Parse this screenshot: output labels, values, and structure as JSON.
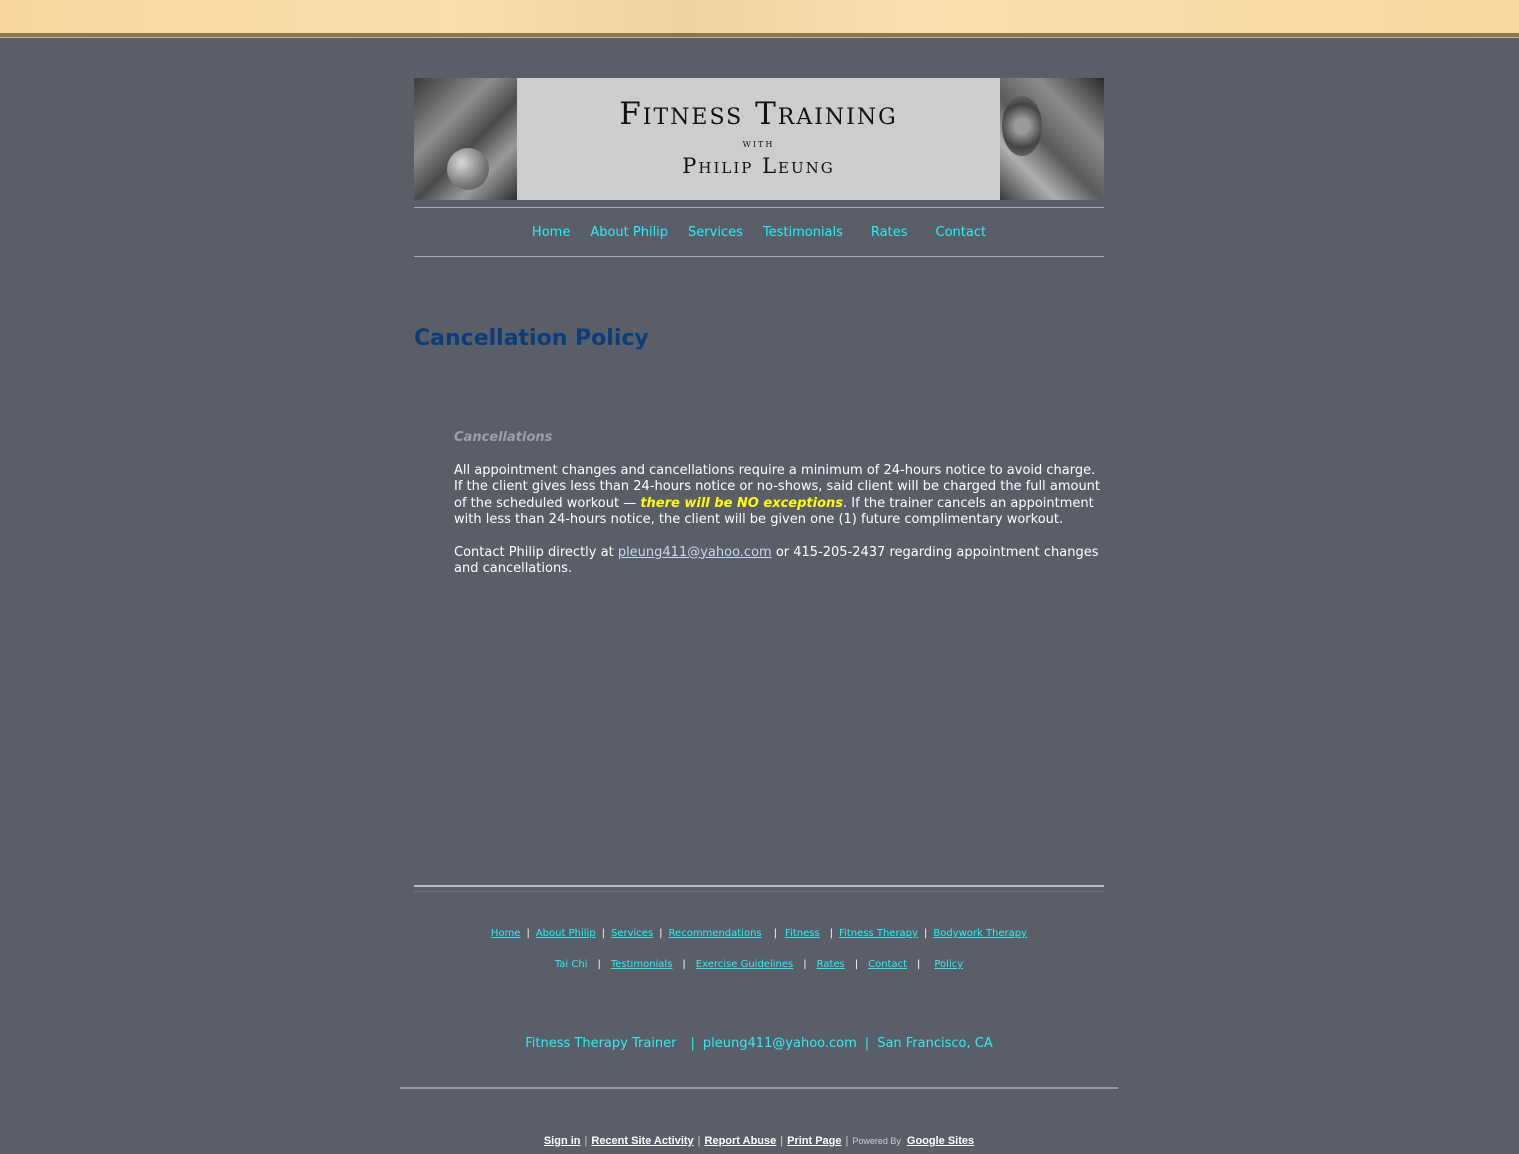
{
  "banner": {
    "title_line1": "Fitness Training",
    "title_line2": "with",
    "title_line3": "Philip Leung"
  },
  "nav": {
    "items": [
      "Home",
      "About Philip",
      "Services",
      "Testimonials",
      "Rates",
      "Contact"
    ]
  },
  "page": {
    "title": "Cancellation Policy",
    "section_heading": "Cancellations",
    "paragraph1_before": "All appointment changes and cancellations require a minimum of 24-hours notice to avoid charge. If the client gives less than 24-hours notice or no-shows, said client will be charged the full amount of the scheduled workout — ",
    "paragraph1_highlight": "there will be NO exceptions",
    "paragraph1_after": ".  If the trainer cancels an appointment with less than 24-hours notice, the client will be given one (1) future complimentary workout.",
    "paragraph2_before": "Contact Philip directly at ",
    "paragraph2_email": "pleung411@yahoo.com",
    "paragraph2_after": " or 415-205-2437 regarding appointment changes and cancellations."
  },
  "footer": {
    "row1": [
      "Home",
      "About Philip",
      "Services",
      "Recommendations",
      "Fitness",
      "Fitness Therapy",
      "Bodywork Therapy"
    ],
    "row2_plain": "Tai Chi",
    "row2": [
      "Testimonials",
      "Exercise Guidelines",
      "Rates",
      "Contact",
      "Policy"
    ],
    "separator": "|",
    "contact_title": "Fitness Therapy Trainer",
    "contact_email": "pleung411@yahoo.com",
    "contact_location": "San Francisco, CA"
  },
  "sites_footer": {
    "sign_in": "Sign in",
    "recent_activity": "Recent Site Activity",
    "report_abuse": "Report Abuse",
    "print_page": "Print Page",
    "powered_by": "Powered By",
    "google_sites": "Google Sites"
  },
  "colors": {
    "background": "#5a5e69",
    "link": "#27f0f4",
    "title": "#0b3e78",
    "highlight": "#ffff00"
  }
}
